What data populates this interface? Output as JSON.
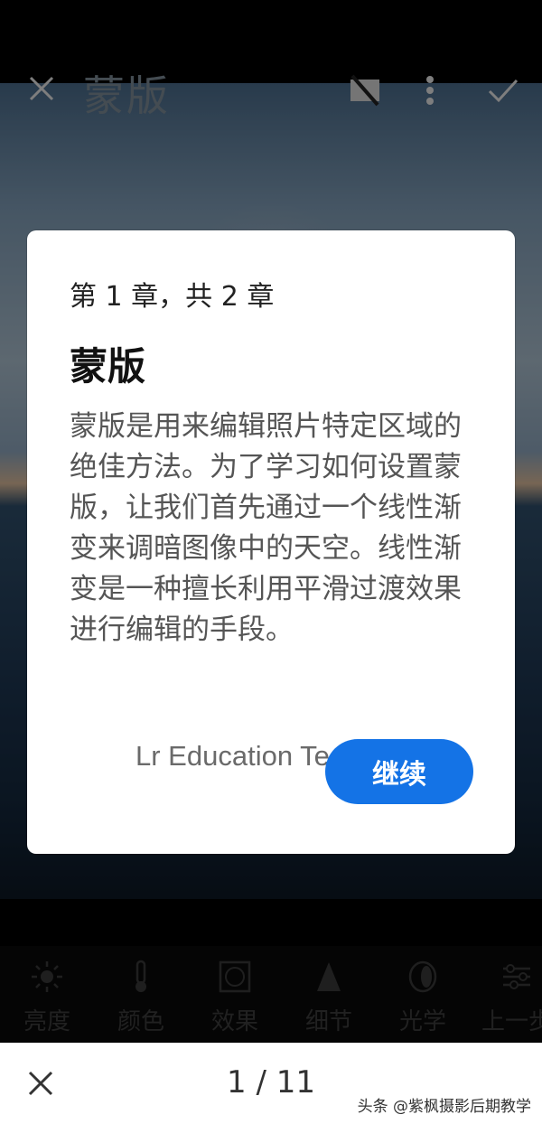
{
  "header": {
    "title": "蒙版"
  },
  "tools": [
    {
      "icon": "sun-icon",
      "label": "亮度"
    },
    {
      "icon": "thermometer-icon",
      "label": "颜色"
    },
    {
      "icon": "vignette-icon",
      "label": "效果"
    },
    {
      "icon": "triangle-icon",
      "label": "细节"
    },
    {
      "icon": "lens-icon",
      "label": "光学"
    },
    {
      "icon": "sliders-icon",
      "label": "上一步"
    }
  ],
  "dialog": {
    "chapter": "第 1 章，共 2 章",
    "title": "蒙版",
    "body": "蒙版是用来编辑照片特定区域的绝佳方法。为了学习如何设置蒙版，让我们首先通过一个线性渐变来调暗图像中的天空。线性渐变是一种擅长利用平滑过渡效果进行编辑的手段。",
    "author": "Lr Education Team",
    "continue_label": "继续"
  },
  "footer": {
    "pager": "1 / 11",
    "watermark": "头条 @紫枫摄影后期教学"
  }
}
